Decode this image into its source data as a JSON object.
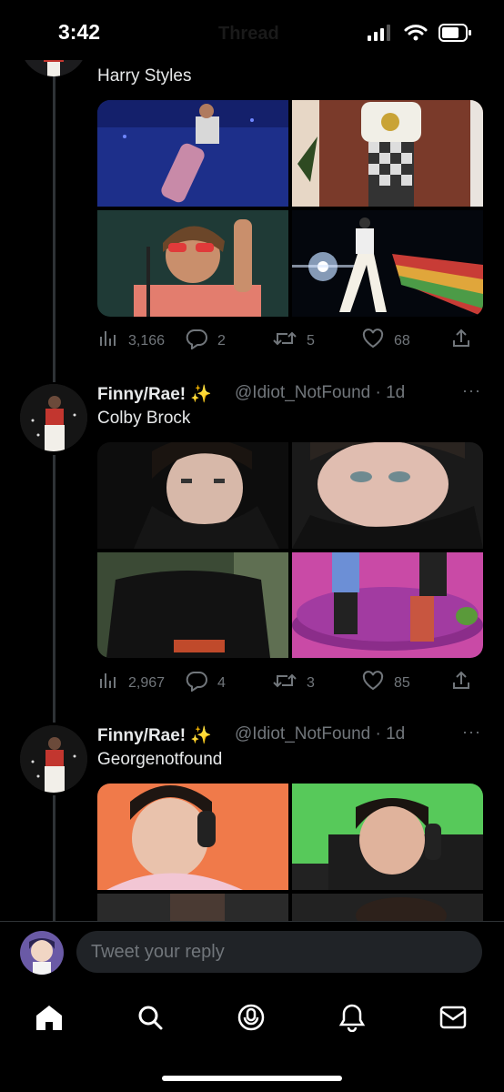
{
  "status_bar": {
    "time": "3:42",
    "faded_title": "Thread"
  },
  "tweets": [
    {
      "text": "Harry Styles",
      "stats": {
        "views": "3,166",
        "replies": "2",
        "retweets": "5",
        "likes": "68"
      }
    },
    {
      "name": "Finny/Rae!",
      "emoji": "✨",
      "handle": "@Idiot_NotFound · 1d",
      "text": "Colby Brock",
      "stats": {
        "views": "2,967",
        "replies": "4",
        "retweets": "3",
        "likes": "85"
      }
    },
    {
      "name": "Finny/Rae!",
      "emoji": "✨",
      "handle": "@Idiot_NotFound · 1d",
      "text": "Georgenotfound"
    }
  ],
  "reply": {
    "placeholder": "Tweet your reply"
  },
  "colors": {
    "background": "#000000",
    "text": "#e7e9ea",
    "muted": "#71767b",
    "input": "#202327"
  },
  "tabs": [
    "home-icon",
    "search-icon",
    "spaces-icon",
    "notifications-icon",
    "messages-icon"
  ]
}
